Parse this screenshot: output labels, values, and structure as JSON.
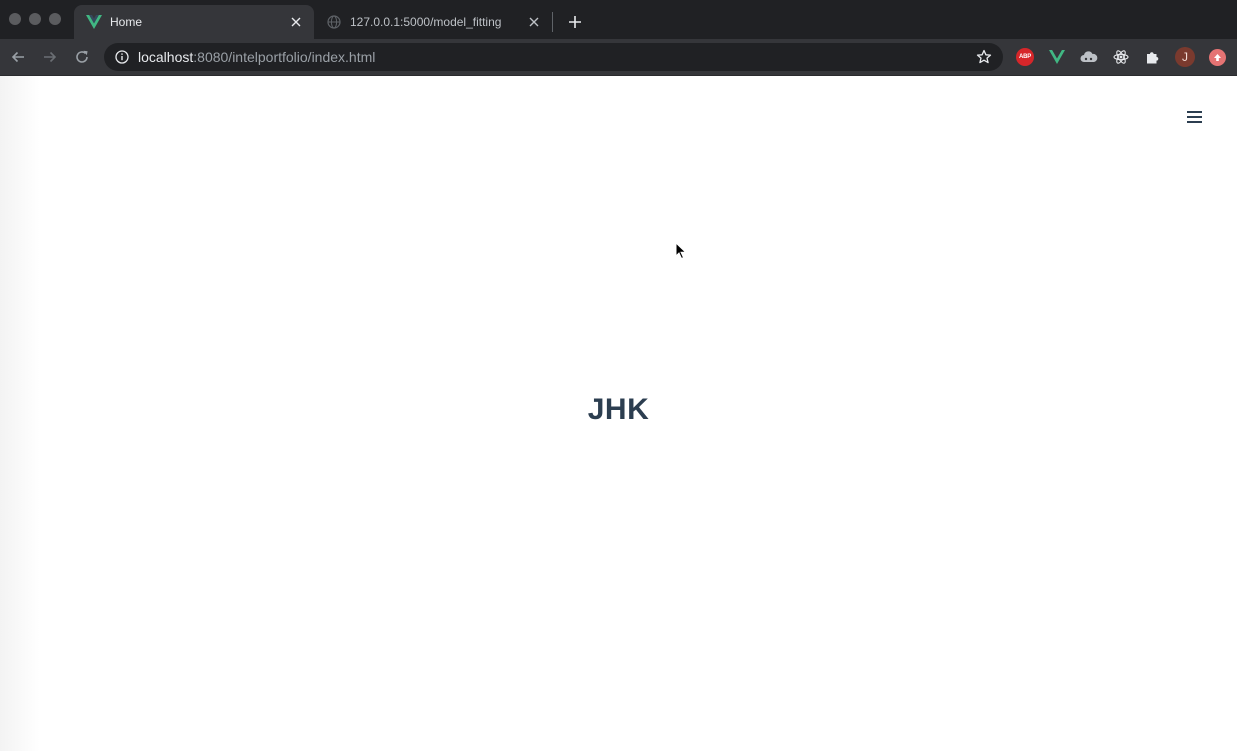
{
  "browser": {
    "tabs": [
      {
        "title": "Home",
        "favicon": "vue-icon",
        "active": true
      },
      {
        "title": "127.0.0.1:5000/model_fitting",
        "favicon": "globe-icon",
        "active": false
      }
    ],
    "address_bar": {
      "host": "localhost",
      "path": ":8080/intelportfolio/index.html"
    },
    "extensions": {
      "abp_label": "ABP",
      "avatar_initial": "J"
    }
  },
  "page": {
    "logo_text": "JHK",
    "menu_icon": "hamburger-menu-icon"
  },
  "colors": {
    "vue_green": "#41b883",
    "text_dark": "#2c3e50",
    "chrome_dark": "#202124",
    "chrome_toolbar": "#35363a"
  }
}
